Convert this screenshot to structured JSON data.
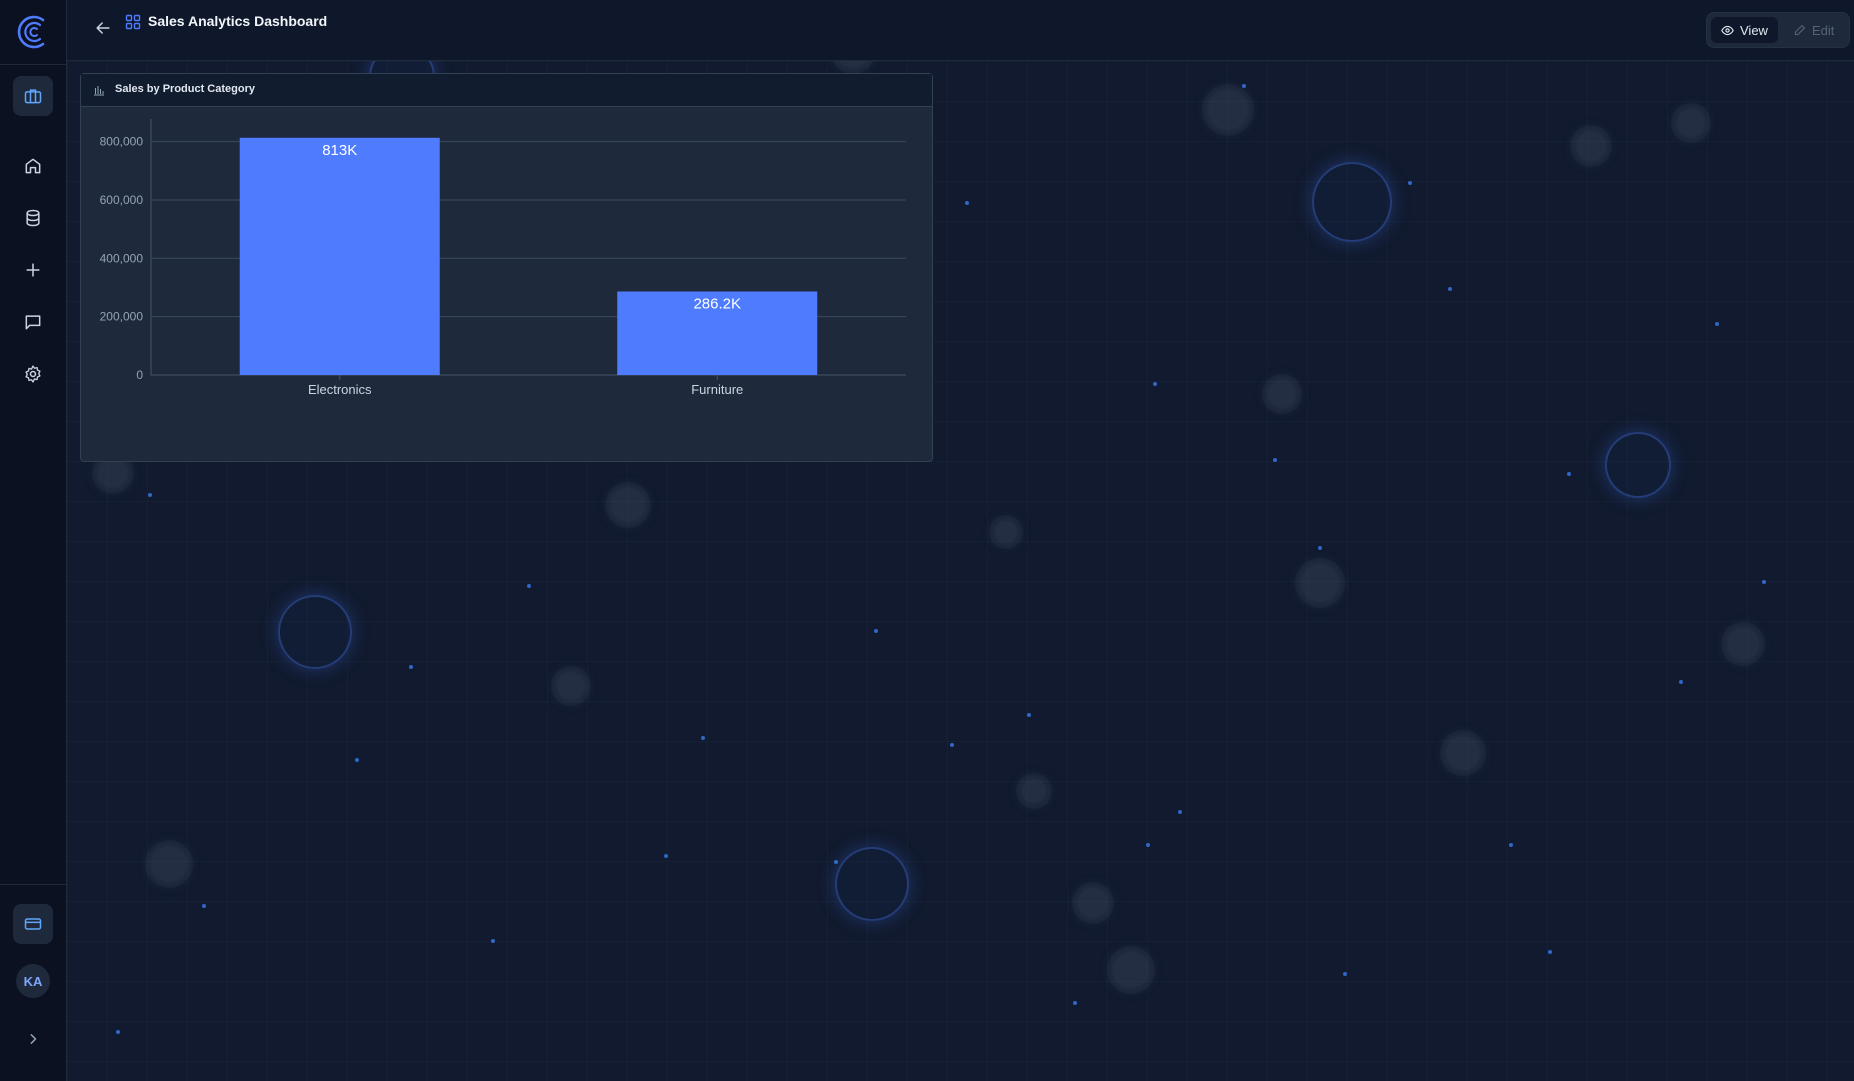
{
  "app": {
    "title": "Sales Analytics Dashboard",
    "logo_icon": "crescent-logo-icon"
  },
  "sidebar": {
    "items": [
      {
        "name": "briefcase-icon",
        "active": true
      },
      {
        "name": "home-icon"
      },
      {
        "name": "database-icon"
      },
      {
        "name": "plus-icon"
      },
      {
        "name": "chat-icon"
      },
      {
        "name": "gear-icon"
      }
    ],
    "bottom": {
      "card_icon": "credit-card-icon",
      "avatar_initials": "KA",
      "expand_icon": "chevron-right-icon"
    }
  },
  "header": {
    "view_label": "View",
    "edit_label": "Edit"
  },
  "widget": {
    "title": "Sales by Product Category"
  },
  "colors": {
    "accent": "#4f7cff",
    "background": "#111a2e",
    "card": "#1e293b"
  },
  "chart_data": {
    "type": "bar",
    "title": "Sales by Product Category",
    "categories": [
      "Electronics",
      "Furniture"
    ],
    "values": [
      813000,
      286200
    ],
    "data_labels": [
      "813K",
      "286.2K"
    ],
    "yticks": [
      "0",
      "200,000",
      "400,000",
      "600,000",
      "800,000"
    ],
    "ylim": [
      0,
      850000
    ],
    "grid": true,
    "xlabel": "",
    "ylabel": ""
  }
}
